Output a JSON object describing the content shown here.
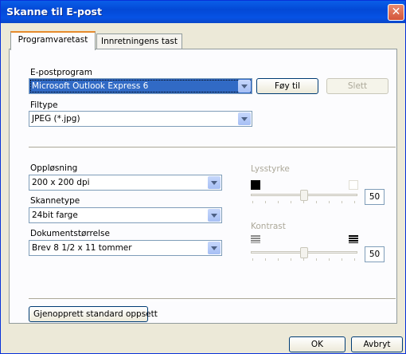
{
  "window": {
    "title": "Skanne til E-post"
  },
  "tabs": [
    {
      "label": "Programvaretast",
      "active": true
    },
    {
      "label": "Innretningens tast",
      "active": false
    }
  ],
  "email": {
    "label": "E-postprogram",
    "selected": "Microsoft Outlook Express 6",
    "add_label": "Føy til",
    "delete_label": "Slett"
  },
  "filetype": {
    "label": "Filtype",
    "selected": "JPEG (*.jpg)"
  },
  "resolution": {
    "label": "Oppløsning",
    "selected": "200 x 200 dpi"
  },
  "scantype": {
    "label": "Skannetype",
    "selected": "24bit farge"
  },
  "docsize": {
    "label": "Dokumentstørrelse",
    "selected": "Brev 8 1/2 x 11 tommer"
  },
  "brightness": {
    "label": "Lysstyrke",
    "value": "50",
    "level": 0.5
  },
  "contrast": {
    "label": "Kontrast",
    "value": "50",
    "level": 0.5
  },
  "restore_label": "Gjenopprett standard oppsett",
  "footer": {
    "ok_label": "OK",
    "cancel_label": "Avbryt"
  }
}
